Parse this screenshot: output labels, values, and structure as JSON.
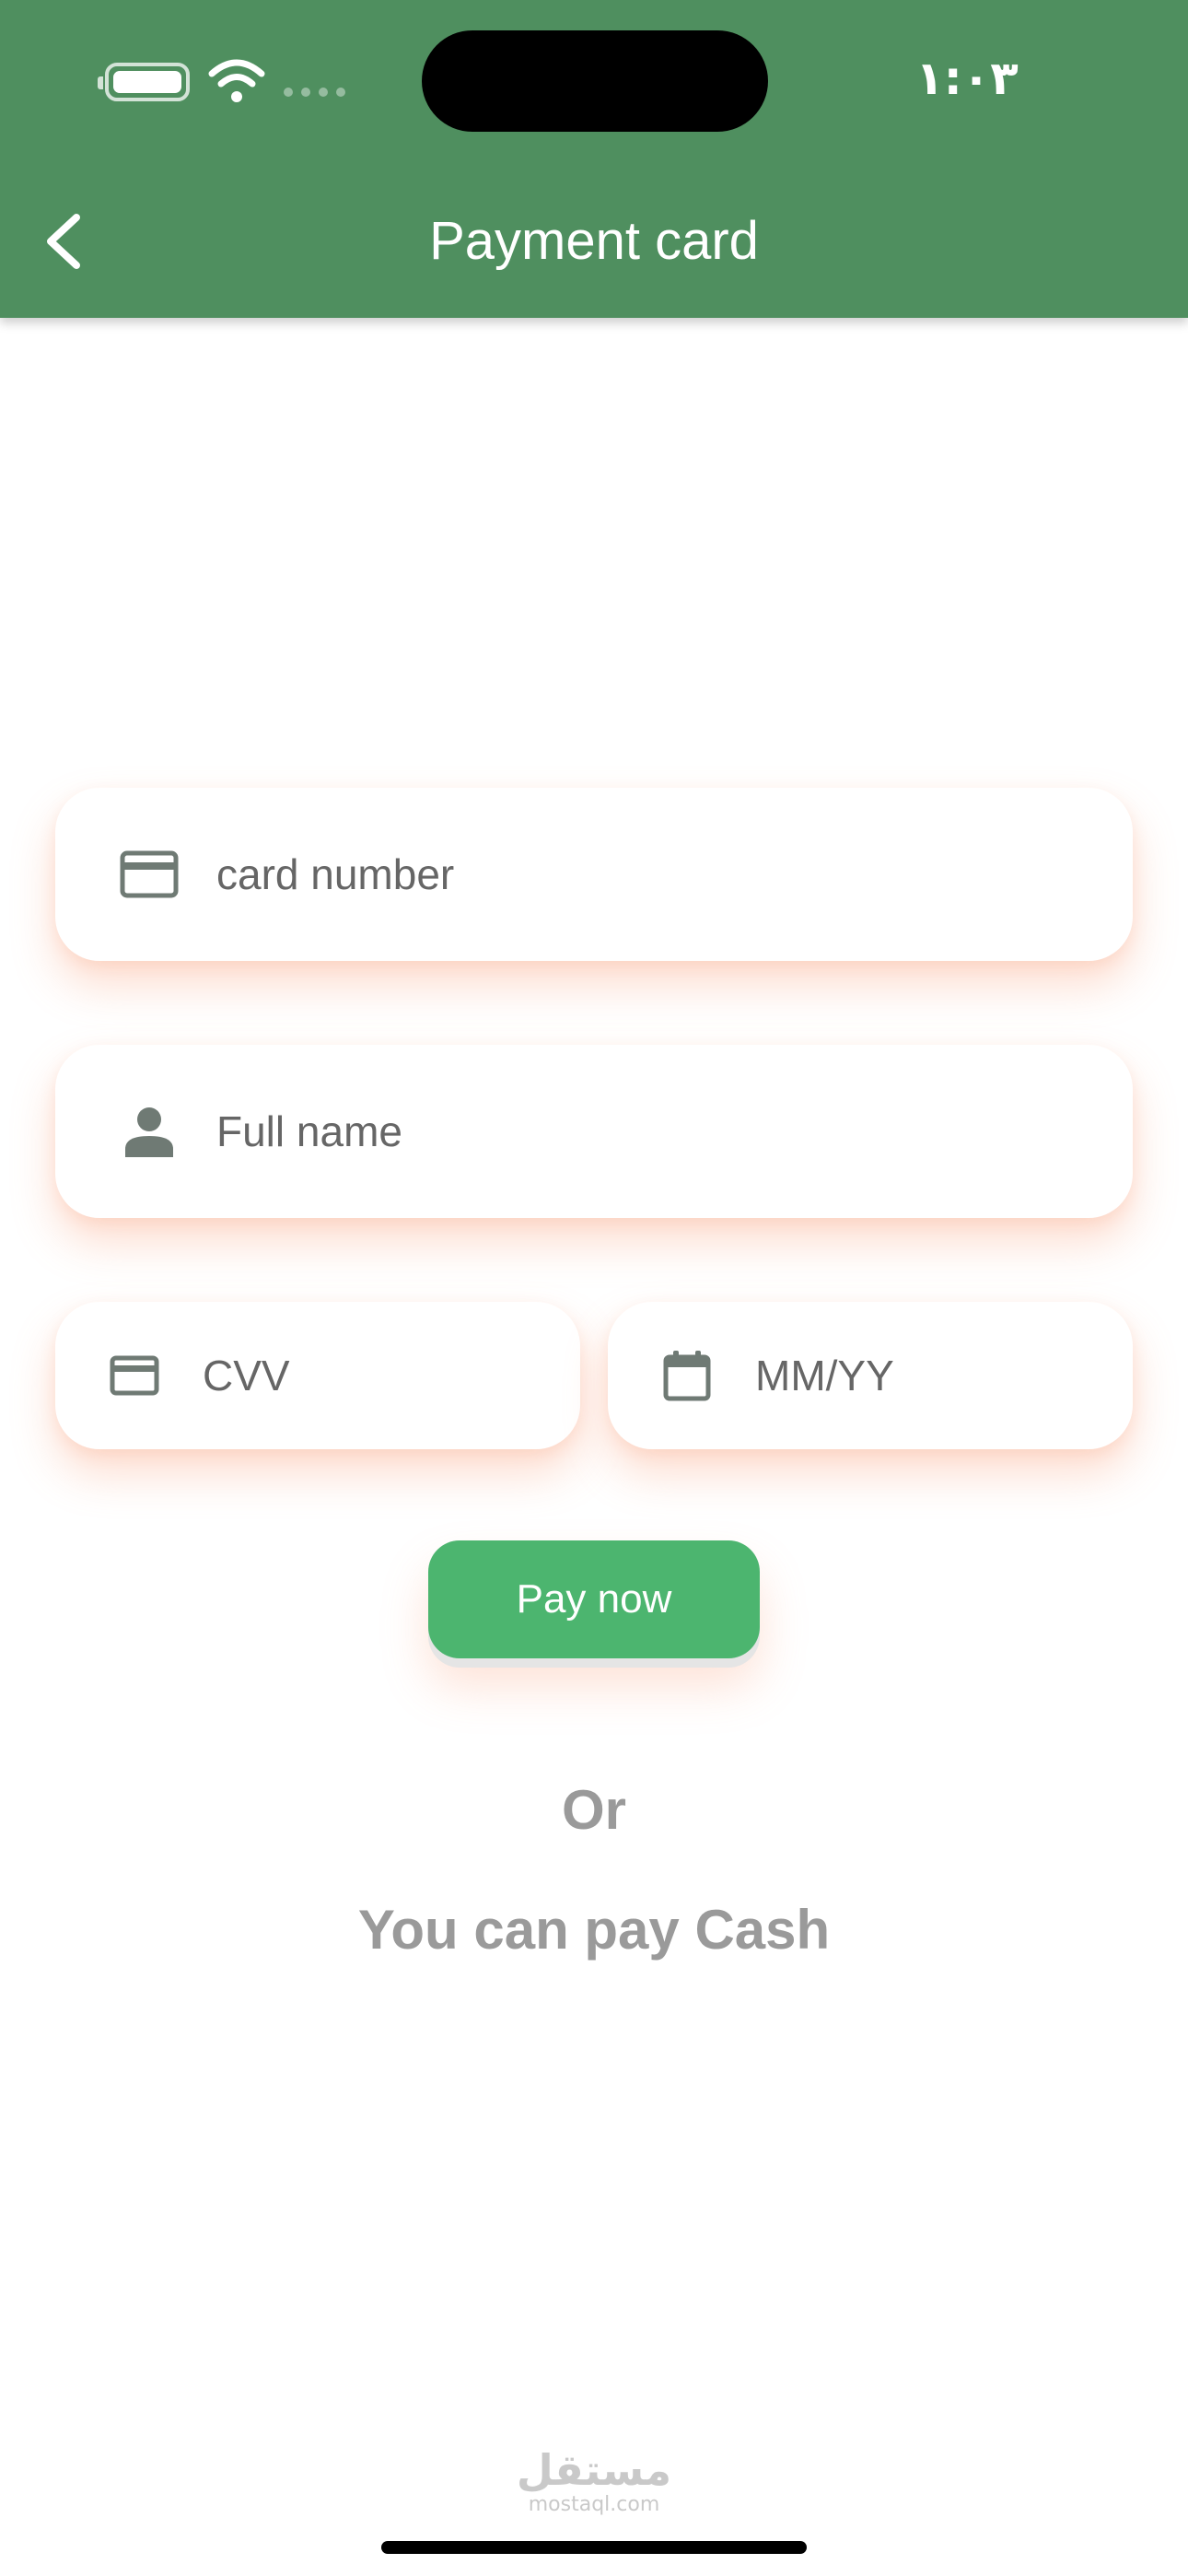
{
  "status_bar": {
    "time": "١:٠٣"
  },
  "header": {
    "title": "Payment card",
    "background_color": "#4f8f5f"
  },
  "form": {
    "card_number": {
      "placeholder": "card number",
      "icon": "credit-card-icon"
    },
    "full_name": {
      "placeholder": "Full name",
      "icon": "person-icon"
    },
    "cvv": {
      "placeholder": "CVV",
      "icon": "credit-card-icon"
    },
    "expiry": {
      "placeholder": "MM/YY",
      "icon": "calendar-icon"
    }
  },
  "actions": {
    "pay_label": "Pay now",
    "pay_color": "#4cb56f"
  },
  "alt_payment": {
    "or_text": "Or",
    "cash_text": "You can pay Cash"
  },
  "watermark": {
    "arabic": "مستقل",
    "domain": "mostaql.com"
  }
}
